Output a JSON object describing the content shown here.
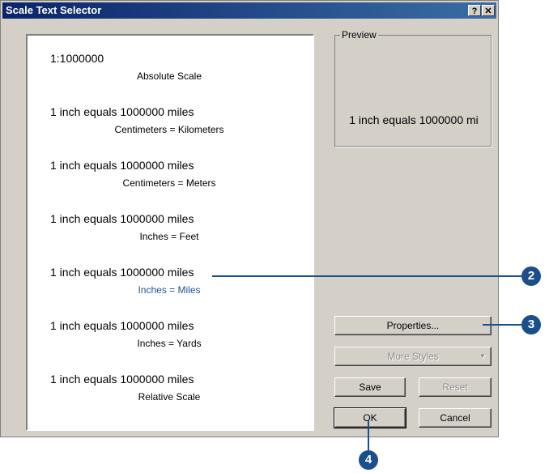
{
  "window": {
    "title": "Scale Text Selector",
    "help_label": "?",
    "close_label": "✕"
  },
  "list": {
    "items": [
      {
        "main": "1:1000000",
        "sub": "Absolute Scale"
      },
      {
        "main": "1 inch equals 1000000 miles",
        "sub": "Centimeters = Kilometers"
      },
      {
        "main": "1 inch equals 1000000 miles",
        "sub": "Centimeters = Meters"
      },
      {
        "main": "1 inch equals 1000000 miles",
        "sub": "Inches = Feet"
      },
      {
        "main": "1 inch equals 1000000 miles",
        "sub": "Inches = Miles",
        "selected": true
      },
      {
        "main": "1 inch equals 1000000 miles",
        "sub": "Inches = Yards"
      },
      {
        "main": "1 inch equals 1000000 miles",
        "sub": "Relative Scale"
      }
    ]
  },
  "preview": {
    "label": "Preview",
    "text": "1 inch equals 1000000 mi"
  },
  "buttons": {
    "properties": "Properties...",
    "more_styles": "More Styles",
    "save": "Save",
    "reset": "Reset",
    "ok": "OK",
    "cancel": "Cancel"
  },
  "callouts": {
    "c2": "2",
    "c3": "3",
    "c4": "4"
  },
  "colors": {
    "callout": "#1a4f8c",
    "selected_text": "#1f4e99",
    "title_bar": "#0a246a"
  }
}
